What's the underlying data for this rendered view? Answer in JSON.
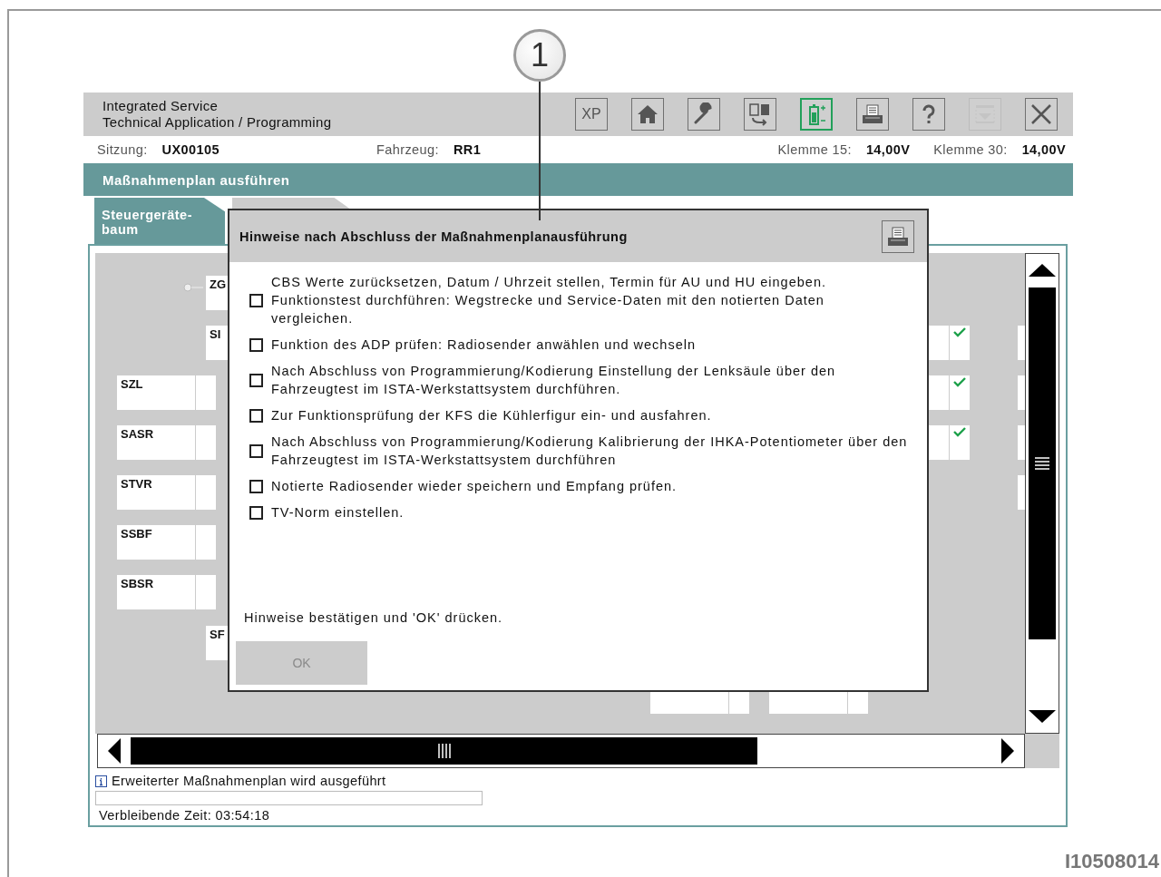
{
  "callout": "1",
  "header": {
    "title_lines": [
      "Integrated Service",
      "Technical Application / Programming"
    ]
  },
  "toolbar": [
    {
      "kind": "xp",
      "label": "XP",
      "active": false,
      "disabled": false
    },
    {
      "kind": "home",
      "active": false,
      "disabled": false
    },
    {
      "kind": "wrench",
      "active": false,
      "disabled": false
    },
    {
      "kind": "swap",
      "active": false,
      "disabled": false
    },
    {
      "kind": "battery",
      "active": true,
      "disabled": false
    },
    {
      "kind": "print",
      "active": false,
      "disabled": false
    },
    {
      "kind": "help",
      "active": false,
      "disabled": false
    },
    {
      "kind": "filter",
      "active": false,
      "disabled": true
    },
    {
      "kind": "close",
      "active": false,
      "disabled": false
    }
  ],
  "info_bar": [
    {
      "label": "Sitzung:",
      "value": "UX00105"
    },
    {
      "label": "Fahrzeug:",
      "value": "RR1"
    },
    {
      "label": "Klemme 15:",
      "value": "14,00V"
    },
    {
      "label": "Klemme 30:",
      "value": "14,00V"
    }
  ],
  "section_title": "Maßnahmenplan ausführen",
  "tabs": [
    {
      "label": "Steuergeräte-baum",
      "selected": true
    },
    {
      "selected": false
    }
  ],
  "tree_nodes": [
    {
      "label": "ZG"
    },
    {
      "label": "SI"
    },
    {
      "label": "SZL",
      "checked": false
    },
    {
      "label": "SASR",
      "checked": false
    },
    {
      "label": "STVR",
      "checked": false
    },
    {
      "label": "SSBF",
      "checked": false
    },
    {
      "label": "SBSR",
      "checked": false
    },
    {
      "label": "SF"
    },
    {
      "checked": true
    },
    {
      "checked": true
    },
    {
      "checked": true
    }
  ],
  "dialog": {
    "title": "Hinweise nach Abschluss der Maßnahmenplanausführung",
    "items": [
      {
        "text": "CBS Werte zurücksetzen, Datum / Uhrzeit stellen, Termin für AU und HU eingeben. Funktionstest durchführen: Wegstrecke und Service-Daten mit den notierten Daten vergleichen.",
        "checked": false
      },
      {
        "text": "Funktion des ADP prüfen: Radiosender anwählen und wechseln",
        "checked": false
      },
      {
        "text": "Nach Abschluss von Programmierung/Kodierung Einstellung der Lenksäule über den Fahrzeugtest im ISTA-Werkstattsystem durchführen.",
        "checked": false
      },
      {
        "text": "Zur Funktionsprüfung der KFS die Kühlerfigur ein- und ausfahren.",
        "checked": false
      },
      {
        "text": "Nach Abschluss von Programmierung/Kodierung Kalibrierung der IHKA-Potentiometer über den Fahrzeugtest im ISTA-Werkstattsystem durchführen",
        "checked": false
      },
      {
        "text": "Notierte Radiosender wieder speichern und Empfang prüfen.",
        "checked": false
      },
      {
        "text": "TV-Norm einstellen.",
        "checked": false
      }
    ],
    "instruction": "Hinweise bestätigen und 'OK' drücken.",
    "ok_button": {
      "label": "OK",
      "disabled": true
    }
  },
  "status": {
    "message": "Erweiterter Maßnahmenplan wird ausgeführt",
    "progress": {
      "level": 0
    },
    "remaining": "Verbleibende Zeit: 03:54:18"
  },
  "figure_id": "I10508014"
}
